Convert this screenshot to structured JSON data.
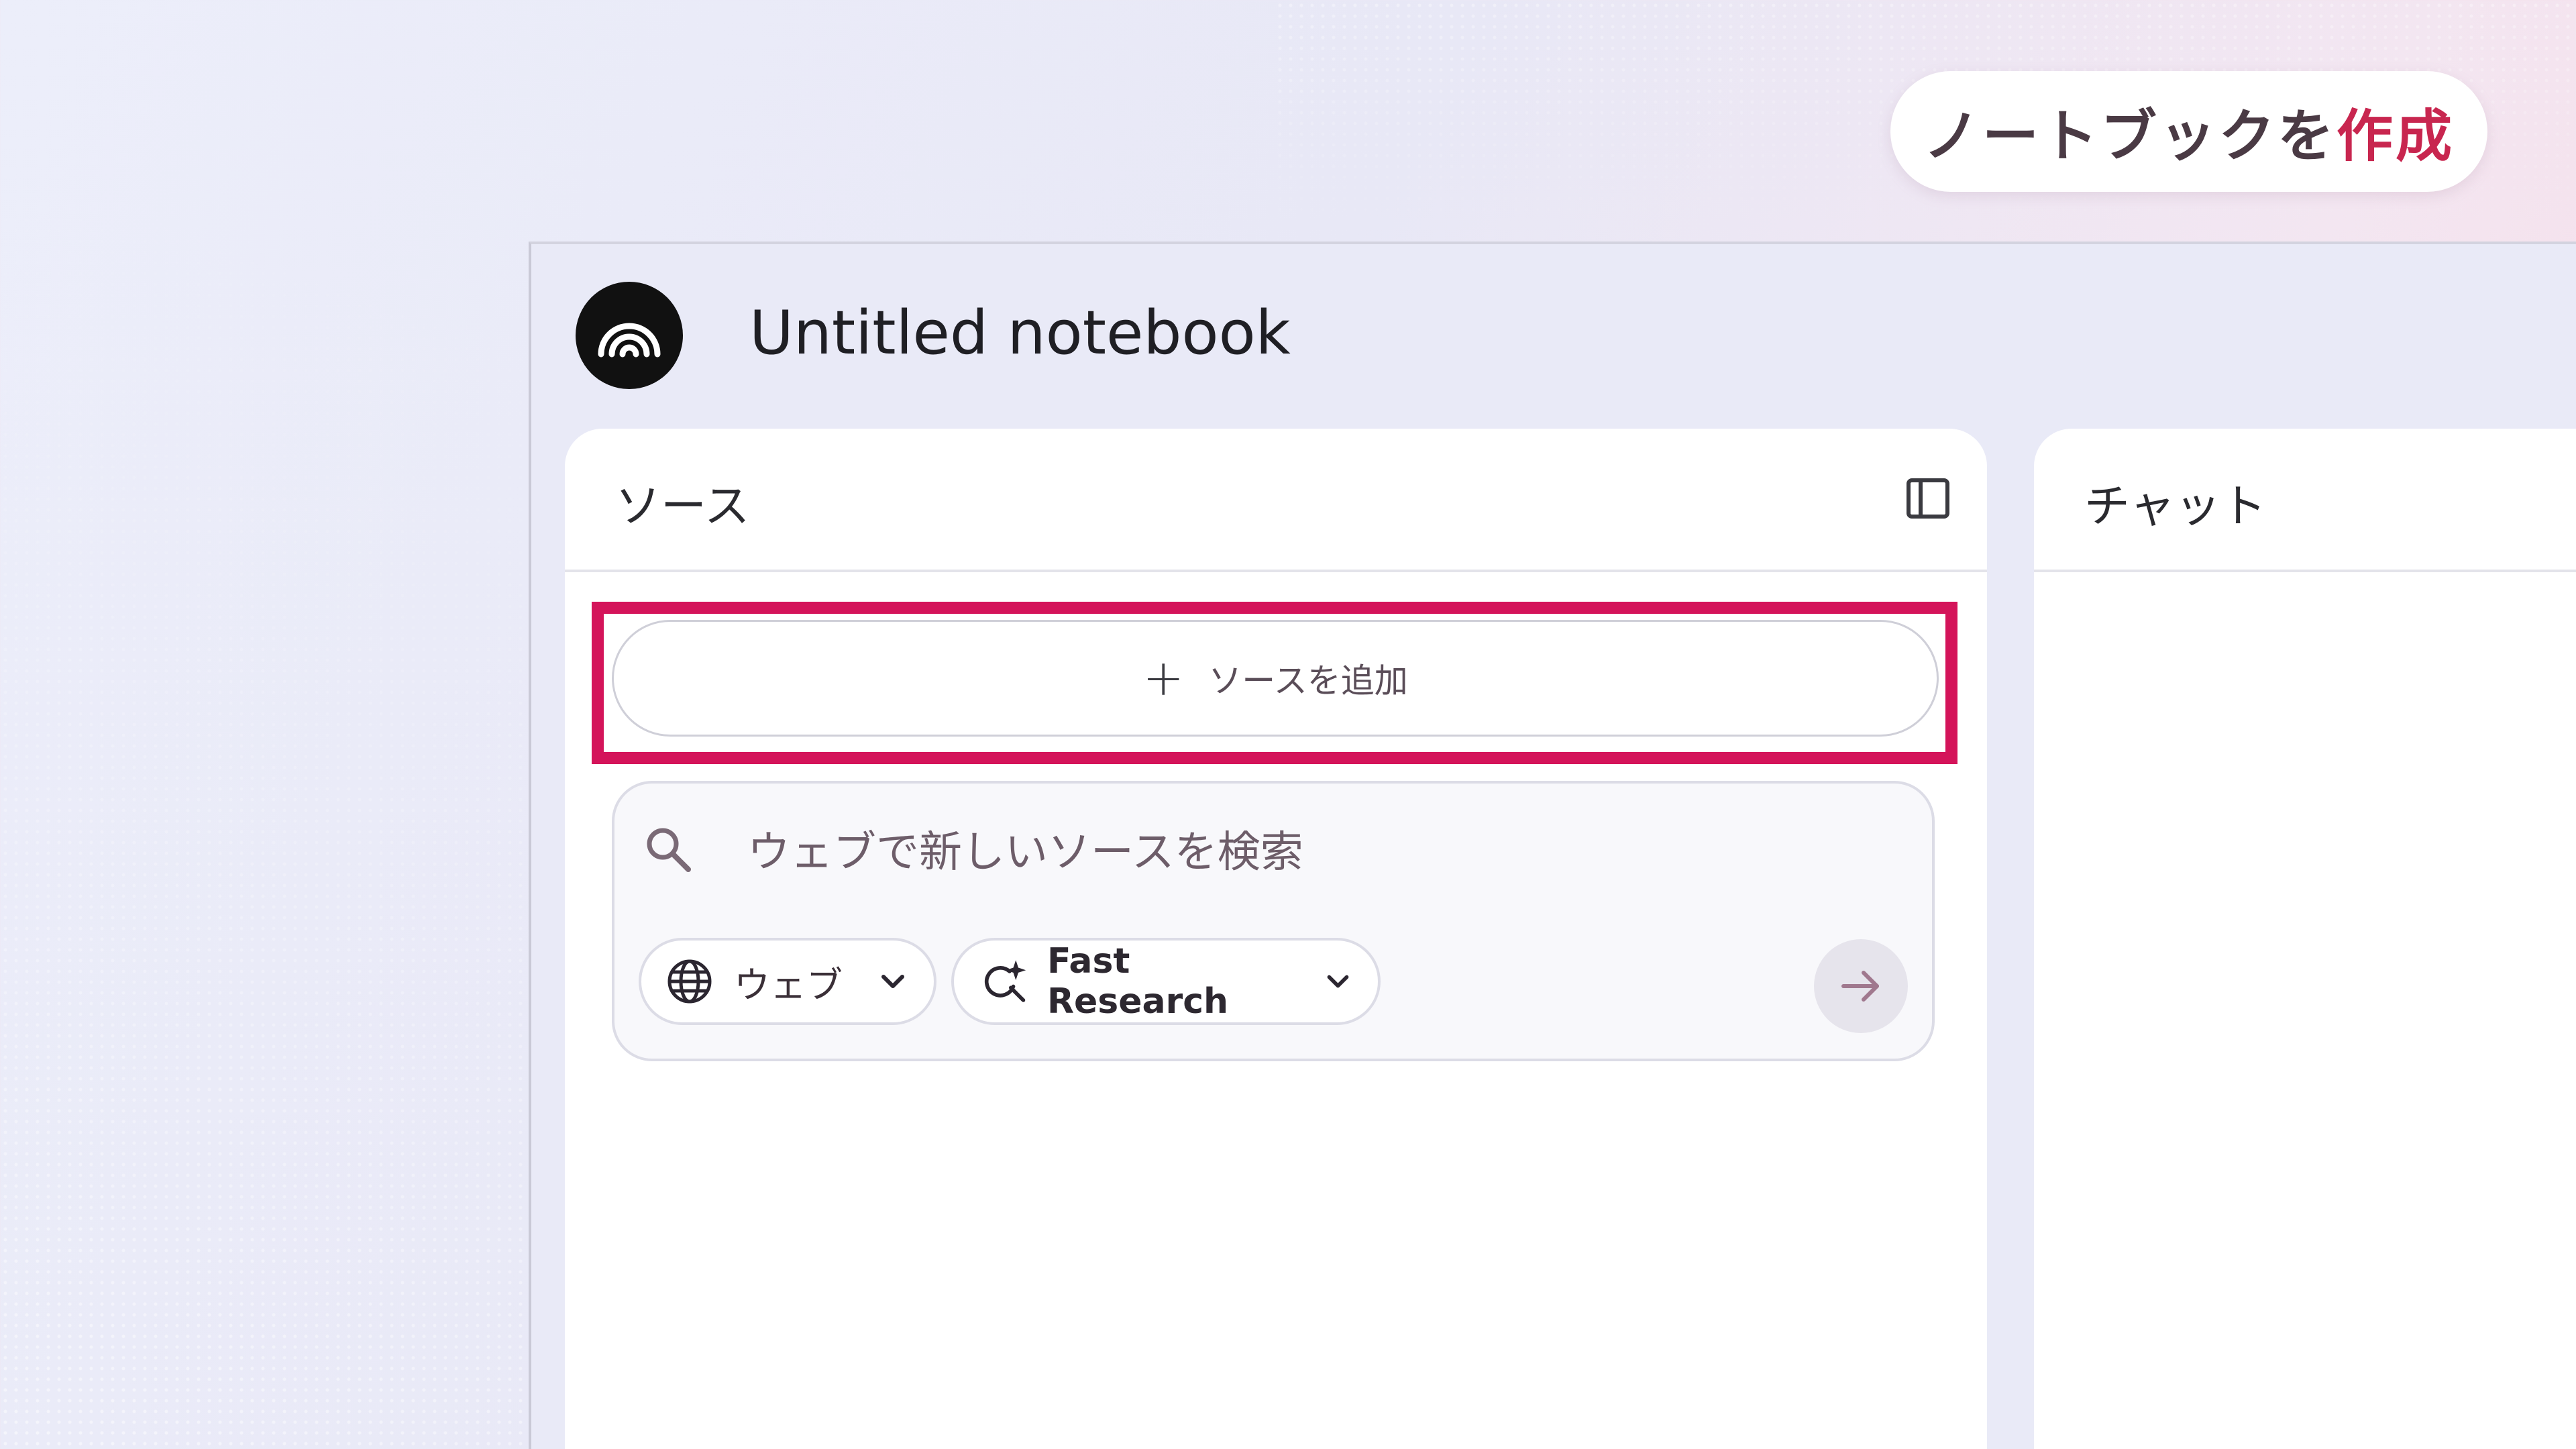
{
  "top_banner": {
    "create_prefix": "ノートブックを",
    "create_suffix": "作成"
  },
  "notebook": {
    "title": "Untitled notebook"
  },
  "sources_panel": {
    "title": "ソース",
    "add_source_label": "ソースを追加",
    "search_placeholder": "ウェブで新しいソースを検索",
    "source_type_chip": "ウェブ",
    "research_mode_chip": "Fast Research"
  },
  "chat_panel": {
    "title": "チャット"
  },
  "colors": {
    "accent": "#d4145a",
    "create_accent": "#c8264f"
  }
}
